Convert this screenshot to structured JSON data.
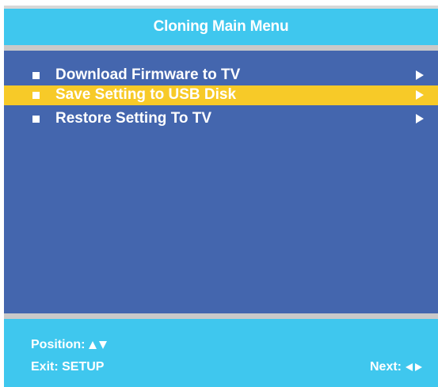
{
  "window": {
    "title": "Cloning Main Menu"
  },
  "menu": {
    "items": [
      {
        "label": "Download Firmware to TV",
        "selected": false,
        "icon": "right-arrow-icon"
      },
      {
        "label": "Save Setting to USB Disk",
        "selected": true,
        "icon": "right-arrow-icon"
      },
      {
        "label": "Restore Setting To TV",
        "selected": false,
        "icon": "right-arrow-icon"
      }
    ]
  },
  "footer": {
    "position_label": "Position:",
    "position_icons": [
      "up-triangle-icon",
      "down-triangle-icon"
    ],
    "exit_label": "Exit: SETUP",
    "next_label": "Next:",
    "next_icons": [
      "left-triangle-icon",
      "right-triangle-icon"
    ]
  },
  "colors": {
    "header_bg": "#3fc7ee",
    "menu_bg": "#4466ae",
    "selected_bg": "#f7ca28",
    "separator": "#c9c9c9",
    "text": "#ffffff"
  }
}
